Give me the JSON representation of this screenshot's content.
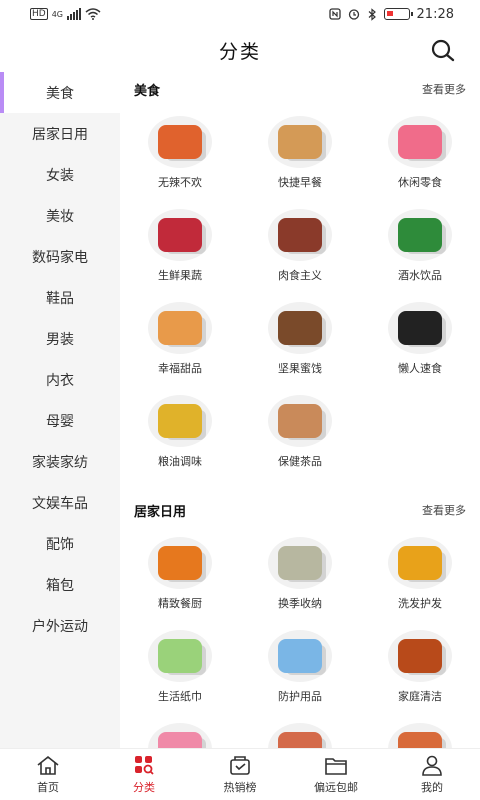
{
  "status": {
    "hd": "HD",
    "net": "4G",
    "time": "21:28"
  },
  "header": {
    "title": "分类"
  },
  "sidebar": {
    "items": [
      {
        "label": "美食"
      },
      {
        "label": "居家日用"
      },
      {
        "label": "女装"
      },
      {
        "label": "美妆"
      },
      {
        "label": "数码家电"
      },
      {
        "label": "鞋品"
      },
      {
        "label": "男装"
      },
      {
        "label": "内衣"
      },
      {
        "label": "母婴"
      },
      {
        "label": "家装家纺"
      },
      {
        "label": "文娱车品"
      },
      {
        "label": "配饰"
      },
      {
        "label": "箱包"
      },
      {
        "label": "户外运动"
      }
    ]
  },
  "sections": [
    {
      "title": "美食",
      "more": "查看更多",
      "items": [
        {
          "label": "无辣不欢",
          "color": "#e0622d"
        },
        {
          "label": "快捷早餐",
          "color": "#d49a56"
        },
        {
          "label": "休闲零食",
          "color": "#f06c8a"
        },
        {
          "label": "生鲜果蔬",
          "color": "#c12a3a"
        },
        {
          "label": "肉食主义",
          "color": "#8a3a2a"
        },
        {
          "label": "酒水饮品",
          "color": "#2e8b3a"
        },
        {
          "label": "幸福甜品",
          "color": "#e89a4a"
        },
        {
          "label": "坚果蜜饯",
          "color": "#7a4a2a"
        },
        {
          "label": "懒人速食",
          "color": "#222222"
        },
        {
          "label": "粮油调味",
          "color": "#e0b22a"
        },
        {
          "label": "保健茶品",
          "color": "#c98a5a"
        }
      ]
    },
    {
      "title": "居家日用",
      "more": "查看更多",
      "items": [
        {
          "label": "精致餐厨",
          "color": "#e6781e"
        },
        {
          "label": "换季收纳",
          "color": "#b7b7a0"
        },
        {
          "label": "洗发护发",
          "color": "#e8a21a"
        },
        {
          "label": "生活纸巾",
          "color": "#9ad27a"
        },
        {
          "label": "防护用品",
          "color": "#7ab6e6"
        },
        {
          "label": "家庭清洁",
          "color": "#b84a1a"
        },
        {
          "label": "",
          "color": "#f08aa8"
        },
        {
          "label": "",
          "color": "#d46a4a"
        },
        {
          "label": "",
          "color": "#d86a3a"
        }
      ]
    }
  ],
  "tabbar": {
    "items": [
      {
        "label": "首页"
      },
      {
        "label": "分类"
      },
      {
        "label": "热销榜"
      },
      {
        "label": "偏远包邮"
      },
      {
        "label": "我的"
      }
    ],
    "active_color": "#d9232c"
  }
}
